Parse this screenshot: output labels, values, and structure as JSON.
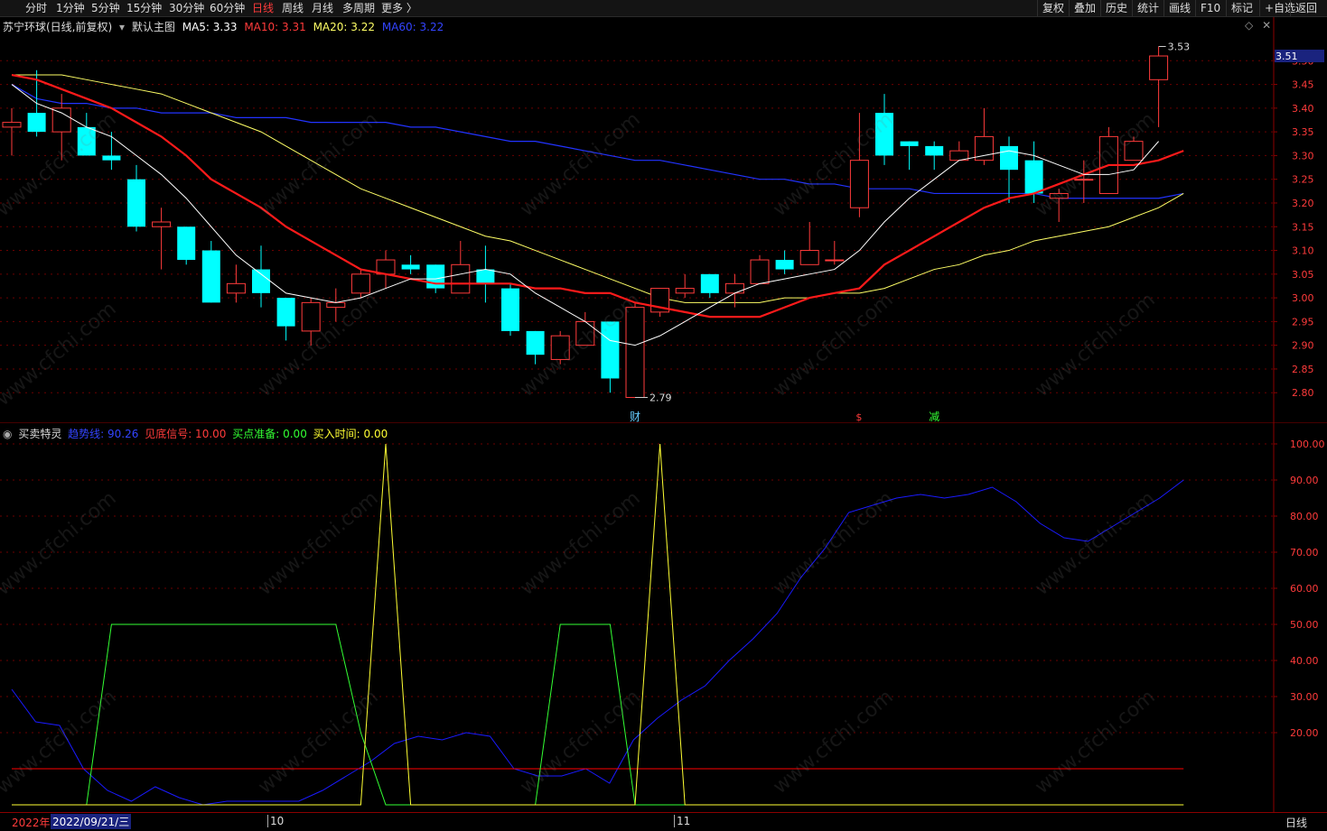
{
  "toolbar": {
    "periods": [
      "分时",
      "1分钟",
      "5分钟",
      "15分钟",
      "30分钟",
      "60分钟",
      "日线",
      "周线",
      "月线",
      "多周期",
      "更多 〉"
    ],
    "active_period": "日线",
    "right_buttons": [
      "复权",
      "叠加",
      "历史",
      "统计",
      "画线",
      "F10",
      "标记",
      "+自选",
      "返回"
    ]
  },
  "main_legend": {
    "stock": "苏宁环球(日线,前复权)",
    "main_chart": "默认主图",
    "ma5": "MA5: 3.33",
    "ma10": "MA10: 3.31",
    "ma20": "MA20: 3.22",
    "ma60": "MA60: 3.22"
  },
  "indicator_legend": {
    "name": "买卖特灵",
    "trend": "趋势线: 90.26",
    "bottom": "见底信号: 10.00",
    "prep": "买点准备: 0.00",
    "buytime": "买入时间: 0.00"
  },
  "annotations": {
    "high_label": "3.53",
    "low_label": "2.79",
    "last_price": "3.51",
    "marker_cai": "财",
    "marker_s": "$",
    "marker_jian": "减"
  },
  "bottom_bar": {
    "year": "2022年",
    "date": "2022/09/21/三",
    "month_oct": "10",
    "month_nov": "11",
    "period": "日线"
  },
  "watermark": "www.cfchi.com",
  "colors": {
    "up": "#ff3b3b",
    "down": "#00ffff",
    "ma5": "#ffffff",
    "ma10": "#ff1a1a",
    "ma20": "#ffff66",
    "ma60": "#2233ff",
    "trend": "#1a1aff",
    "bottom_signal": "#ff0000",
    "buy_prep": "#33ff33",
    "buy_time": "#ffff33"
  },
  "chart_data": [
    {
      "type": "candlestick",
      "y_ticks": [
        2.8,
        2.85,
        2.9,
        2.95,
        3.0,
        3.05,
        3.1,
        3.15,
        3.2,
        3.25,
        3.3,
        3.35,
        3.4,
        3.45,
        3.5
      ],
      "ylim": [
        2.77,
        3.55
      ],
      "candles": [
        [
          3.36,
          3.37,
          3.3,
          3.4
        ],
        [
          3.39,
          3.35,
          3.34,
          3.48
        ],
        [
          3.35,
          3.4,
          3.29,
          3.43
        ],
        [
          3.36,
          3.3,
          3.3,
          3.39
        ],
        [
          3.3,
          3.29,
          3.27,
          3.35
        ],
        [
          3.25,
          3.15,
          3.14,
          3.28
        ],
        [
          3.15,
          3.16,
          3.06,
          3.19
        ],
        [
          3.15,
          3.08,
          3.07,
          3.15
        ],
        [
          3.1,
          2.99,
          2.99,
          3.12
        ],
        [
          3.01,
          3.03,
          2.99,
          3.07
        ],
        [
          3.06,
          3.01,
          2.98,
          3.11
        ],
        [
          3.0,
          2.94,
          2.91,
          3.0
        ],
        [
          2.93,
          2.99,
          2.9,
          3.0
        ],
        [
          2.98,
          2.99,
          2.95,
          3.02
        ],
        [
          3.01,
          3.05,
          3.0,
          3.06
        ],
        [
          3.05,
          3.08,
          3.02,
          3.1
        ],
        [
          3.07,
          3.06,
          3.05,
          3.09
        ],
        [
          3.07,
          3.02,
          3.01,
          3.07
        ],
        [
          3.01,
          3.07,
          3.01,
          3.12
        ],
        [
          3.06,
          3.03,
          2.99,
          3.11
        ],
        [
          3.02,
          2.93,
          2.92,
          3.03
        ],
        [
          2.93,
          2.88,
          2.86,
          2.93
        ],
        [
          2.87,
          2.92,
          2.86,
          2.93
        ],
        [
          2.9,
          2.95,
          2.9,
          2.97
        ],
        [
          2.95,
          2.83,
          2.8,
          2.95
        ],
        [
          2.79,
          2.98,
          2.79,
          2.99
        ],
        [
          2.97,
          3.02,
          2.96,
          3.02
        ],
        [
          3.01,
          3.02,
          3.0,
          3.05
        ],
        [
          3.05,
          3.01,
          3.0,
          3.05
        ],
        [
          3.01,
          3.03,
          2.98,
          3.05
        ],
        [
          3.03,
          3.08,
          3.03,
          3.09
        ],
        [
          3.08,
          3.06,
          3.05,
          3.1
        ],
        [
          3.07,
          3.1,
          3.07,
          3.16
        ],
        [
          3.08,
          3.08,
          3.07,
          3.12
        ],
        [
          3.19,
          3.29,
          3.17,
          3.39
        ],
        [
          3.39,
          3.3,
          3.28,
          3.43
        ],
        [
          3.33,
          3.32,
          3.27,
          3.33
        ],
        [
          3.32,
          3.3,
          3.27,
          3.33
        ],
        [
          3.29,
          3.31,
          3.29,
          3.33
        ],
        [
          3.29,
          3.34,
          3.28,
          3.4
        ],
        [
          3.32,
          3.27,
          3.2,
          3.34
        ],
        [
          3.29,
          3.22,
          3.2,
          3.33
        ],
        [
          3.21,
          3.22,
          3.16,
          3.23
        ],
        [
          3.25,
          3.25,
          3.2,
          3.29
        ],
        [
          3.22,
          3.34,
          3.22,
          3.36
        ],
        [
          3.29,
          3.33,
          3.29,
          3.34
        ],
        [
          3.46,
          3.51,
          3.36,
          3.53
        ]
      ],
      "ma5": [
        3.45,
        3.41,
        3.39,
        3.36,
        3.34,
        3.3,
        3.26,
        3.21,
        3.15,
        3.09,
        3.05,
        3.01,
        3.0,
        2.99,
        3.0,
        3.02,
        3.04,
        3.04,
        3.05,
        3.06,
        3.05,
        3.01,
        2.98,
        2.95,
        2.91,
        2.9,
        2.92,
        2.95,
        2.98,
        3.01,
        3.03,
        3.04,
        3.05,
        3.06,
        3.1,
        3.16,
        3.21,
        3.25,
        3.29,
        3.3,
        3.31,
        3.3,
        3.28,
        3.26,
        3.26,
        3.27,
        3.33
      ],
      "ma10": [
        3.47,
        3.46,
        3.44,
        3.42,
        3.4,
        3.37,
        3.34,
        3.3,
        3.25,
        3.22,
        3.19,
        3.15,
        3.12,
        3.09,
        3.06,
        3.05,
        3.04,
        3.03,
        3.03,
        3.03,
        3.03,
        3.02,
        3.02,
        3.01,
        3.01,
        2.99,
        2.98,
        2.97,
        2.96,
        2.96,
        2.96,
        2.98,
        3.0,
        3.01,
        3.02,
        3.07,
        3.1,
        3.13,
        3.16,
        3.19,
        3.21,
        3.22,
        3.24,
        3.26,
        3.28,
        3.28,
        3.29,
        3.31
      ],
      "ma20": [
        3.47,
        3.47,
        3.47,
        3.46,
        3.45,
        3.44,
        3.43,
        3.41,
        3.39,
        3.37,
        3.35,
        3.32,
        3.29,
        3.26,
        3.23,
        3.21,
        3.19,
        3.17,
        3.15,
        3.13,
        3.12,
        3.1,
        3.08,
        3.06,
        3.04,
        3.02,
        3.0,
        2.99,
        2.99,
        2.99,
        2.99,
        3.0,
        3.0,
        3.01,
        3.01,
        3.02,
        3.04,
        3.06,
        3.07,
        3.09,
        3.1,
        3.12,
        3.13,
        3.14,
        3.15,
        3.17,
        3.19,
        3.22
      ],
      "ma60": [
        3.45,
        3.42,
        3.41,
        3.41,
        3.4,
        3.4,
        3.39,
        3.39,
        3.39,
        3.38,
        3.38,
        3.38,
        3.37,
        3.37,
        3.37,
        3.37,
        3.36,
        3.36,
        3.35,
        3.34,
        3.33,
        3.33,
        3.32,
        3.31,
        3.3,
        3.29,
        3.29,
        3.28,
        3.27,
        3.26,
        3.25,
        3.25,
        3.24,
        3.24,
        3.23,
        3.23,
        3.23,
        3.22,
        3.22,
        3.22,
        3.22,
        3.22,
        3.21,
        3.21,
        3.21,
        3.21,
        3.21,
        3.22
      ]
    },
    {
      "type": "line",
      "y_ticks": [
        20,
        30,
        40,
        50,
        60,
        70,
        80,
        90,
        100
      ],
      "ylim": [
        0,
        103
      ],
      "series": [
        {
          "name": "趋势线",
          "values": [
            32,
            23,
            22,
            10,
            4,
            1,
            5,
            2,
            0,
            1,
            1,
            1,
            1,
            4,
            8,
            12,
            17,
            19,
            18,
            20,
            19,
            10,
            8,
            8,
            10,
            6,
            18,
            24,
            29,
            33,
            40,
            46,
            53,
            63,
            71,
            81,
            83,
            85,
            86,
            85,
            86,
            88,
            84,
            78,
            74,
            73,
            77,
            81,
            85,
            90
          ]
        },
        {
          "name": "见底信号",
          "values": [
            10,
            10,
            10,
            10,
            10,
            10,
            10,
            10,
            10,
            10,
            10,
            10,
            10,
            10,
            10,
            10,
            10,
            10,
            10,
            10,
            10,
            10,
            10,
            10,
            10,
            10,
            10,
            10,
            10,
            10,
            10,
            10,
            10,
            10,
            10,
            10,
            10,
            10,
            10,
            10,
            10,
            10,
            10,
            10,
            10,
            10,
            10,
            10
          ]
        },
        {
          "name": "买点准备",
          "values": [
            0,
            0,
            0,
            0,
            50,
            50,
            50,
            50,
            50,
            50,
            50,
            50,
            50,
            50,
            20,
            0,
            0,
            0,
            0,
            0,
            0,
            0,
            50,
            50,
            50,
            0,
            0,
            0,
            0,
            0,
            0,
            0,
            0,
            0,
            0,
            0,
            0,
            0,
            0,
            0,
            0,
            0,
            0,
            0,
            0,
            0,
            0,
            0
          ]
        },
        {
          "name": "买入时间",
          "values": [
            0,
            0,
            0,
            0,
            0,
            0,
            0,
            0,
            0,
            0,
            0,
            0,
            0,
            0,
            0,
            100,
            0,
            0,
            0,
            0,
            0,
            0,
            0,
            0,
            0,
            0,
            100,
            0,
            0,
            0,
            0,
            0,
            0,
            0,
            0,
            0,
            0,
            0,
            0,
            0,
            0,
            0,
            0,
            0,
            0,
            0,
            0,
            0
          ]
        }
      ]
    }
  ]
}
